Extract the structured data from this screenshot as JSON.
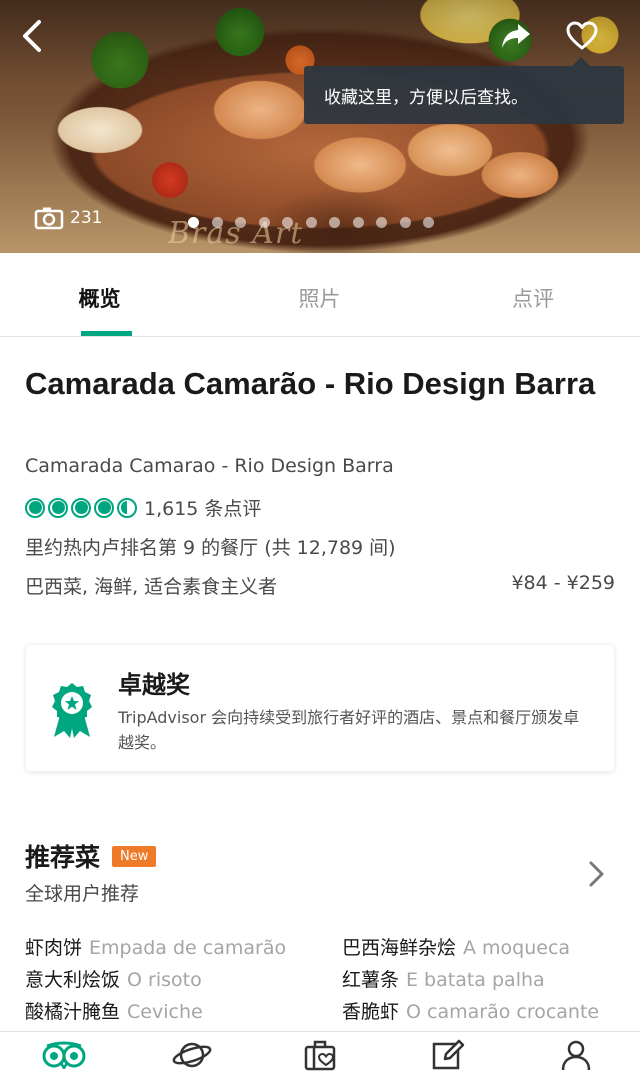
{
  "hero": {
    "photo_count": "231",
    "tooltip": "收藏这里，方便以后查找。",
    "watermark": "Bras Art",
    "slide_count": 11,
    "active_slide": 0
  },
  "tabs": [
    {
      "label": "概览",
      "active": true
    },
    {
      "label": "照片",
      "active": false
    },
    {
      "label": "点评",
      "active": false
    }
  ],
  "restaurant": {
    "name": "Camarada Camarão - Rio Design Barra",
    "alt_name": "Camarada Camarao - Rio Design Barra",
    "rating": 4.5,
    "review_count": "1,615 条点评",
    "rank": "里约热内卢排名第 9 的餐厅 (共 12,789 间)",
    "cuisine": "巴西菜, 海鲜, 适合素食主义者",
    "price": "¥84 - ¥259"
  },
  "award": {
    "title": "卓越奖",
    "description": "TripAdvisor 会向持续受到旅行者好评的酒店、景点和餐厅颁发卓越奖。"
  },
  "recommended": {
    "title": "推荐菜",
    "badge": "New",
    "subtitle": "全球用户推荐",
    "dishes": [
      {
        "zh": "虾肉饼",
        "pt": "Empada de camarão"
      },
      {
        "zh": "巴西海鲜杂烩",
        "pt": "A moqueca"
      },
      {
        "zh": "意大利烩饭",
        "pt": "O risoto"
      },
      {
        "zh": "红薯条",
        "pt": "E batata palha"
      },
      {
        "zh": "酸橘汁腌鱼",
        "pt": "Ceviche"
      },
      {
        "zh": "香脆虾",
        "pt": "O camarão crocante"
      }
    ]
  },
  "colors": {
    "accent": "#00a680",
    "badge": "#ef7a27",
    "tooltip_bg": "#2c3640"
  },
  "icons": {
    "back": "back-arrow-icon",
    "share": "share-icon",
    "favorite": "heart-icon",
    "camera": "camera-icon",
    "award": "award-ribbon-icon",
    "chevron": "chevron-right-icon",
    "nav": [
      "tripadvisor-owl-icon",
      "planet-icon",
      "suitcase-heart-icon",
      "edit-review-icon",
      "profile-icon"
    ]
  }
}
